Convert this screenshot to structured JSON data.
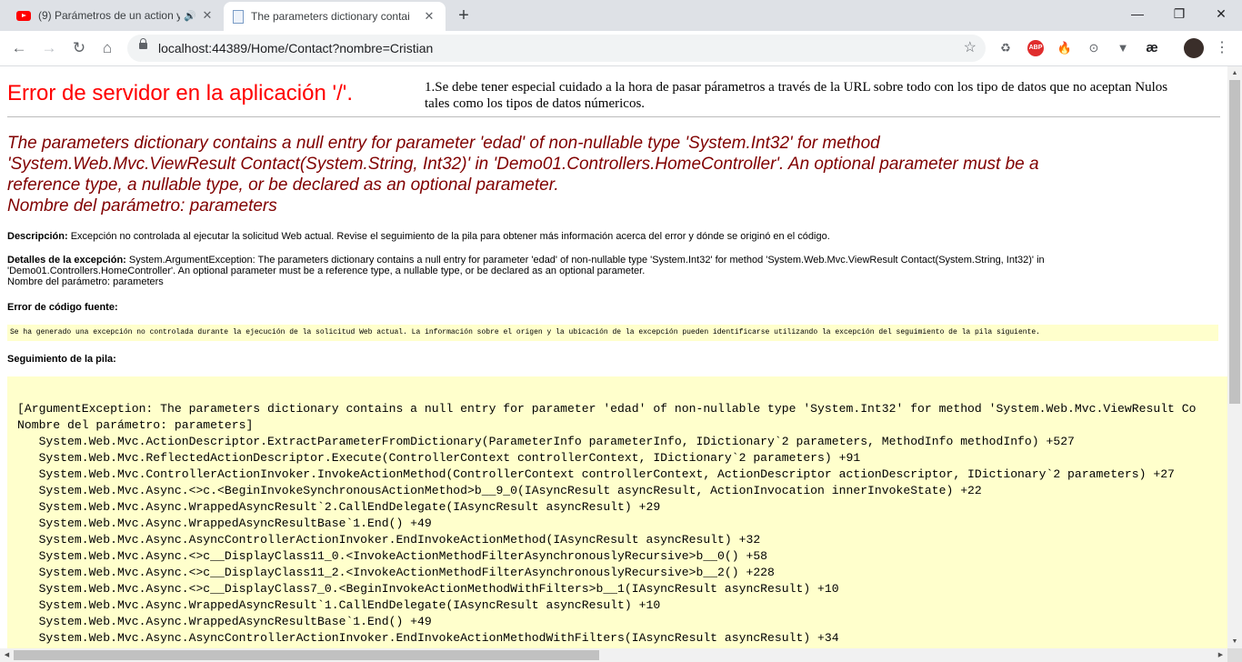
{
  "browser": {
    "tabs": [
      {
        "title": "(9) Parámetros de un action y",
        "icon": "youtube-icon",
        "audio": true
      },
      {
        "title": "The parameters dictionary contai",
        "icon": "document-icon",
        "active": true
      }
    ],
    "new_tab_symbol": "+",
    "window_controls": {
      "minimize": "—",
      "maximize": "❐",
      "close": "✕"
    },
    "nav": {
      "back": "←",
      "forward": "→",
      "reload": "↻",
      "home": "⌂"
    },
    "url": "localhost:44389/Home/Contact?nombre=Cristian",
    "star": "☆",
    "extensions": [
      {
        "name": "recycle-extension-icon",
        "symbol": "♻"
      },
      {
        "name": "adblock-plus-icon",
        "symbol": "ABP"
      },
      {
        "name": "fire-extension-icon",
        "symbol": "🔥"
      },
      {
        "name": "code-extension-icon",
        "symbol": "⊙"
      },
      {
        "name": "v-extension-icon",
        "symbol": "▼"
      },
      {
        "name": "ae-extension-icon",
        "symbol": "æ"
      }
    ],
    "menu": "⋮"
  },
  "page": {
    "heading": "Error de servidor en la aplicación '/'.",
    "note": "1.Se debe tener especial cuidado a la hora de pasar párametros a través de la URL sobre todo con los tipo de datos que no aceptan Nulos tales como los tipos de datos númericos.",
    "error_title_lines": [
      "The parameters dictionary contains a null entry for parameter 'edad' of non-nullable type 'System.Int32' for method",
      "'System.Web.Mvc.ViewResult Contact(System.String, Int32)' in 'Demo01.Controllers.HomeController'. An optional parameter must be a",
      "reference type, a nullable type, or be declared as an optional parameter.",
      "Nombre del parámetro: parameters"
    ],
    "description_label": "Descripción:",
    "description_text": "Excepción no controlada al ejecutar la solicitud Web actual. Revise el seguimiento de la pila para obtener más información acerca del error y dónde se originó en el código.",
    "exception_label": "Detalles de la excepción:",
    "exception_lines": [
      "System.ArgumentException: The parameters dictionary contains a null entry for parameter 'edad' of non-nullable type 'System.Int32' for method 'System.Web.Mvc.ViewResult Contact(System.String, Int32)' in",
      "'Demo01.Controllers.HomeController'. An optional parameter must be a reference type, a nullable type, or be declared as an optional parameter.",
      "Nombre del parámetro: parameters"
    ],
    "source_error_label": "Error de código fuente:",
    "source_error_text": "Se ha generado una excepción no controlada durante la ejecución de la solicitud Web actual. La información sobre el origen y la ubicación de la excepción pueden identificarse utilizando la excepción del seguimiento de la pila siguiente.",
    "stack_label": "Seguimiento de la pila:",
    "stack_lines": [
      "[ArgumentException: The parameters dictionary contains a null entry for parameter 'edad' of non-nullable type 'System.Int32' for method 'System.Web.Mvc.ViewResult Co",
      "Nombre del parámetro: parameters]",
      "   System.Web.Mvc.ActionDescriptor.ExtractParameterFromDictionary(ParameterInfo parameterInfo, IDictionary`2 parameters, MethodInfo methodInfo) +527",
      "   System.Web.Mvc.ReflectedActionDescriptor.Execute(ControllerContext controllerContext, IDictionary`2 parameters) +91",
      "   System.Web.Mvc.ControllerActionInvoker.InvokeActionMethod(ControllerContext controllerContext, ActionDescriptor actionDescriptor, IDictionary`2 parameters) +27",
      "   System.Web.Mvc.Async.<>c.<BeginInvokeSynchronousActionMethod>b__9_0(IAsyncResult asyncResult, ActionInvocation innerInvokeState) +22",
      "   System.Web.Mvc.Async.WrappedAsyncResult`2.CallEndDelegate(IAsyncResult asyncResult) +29",
      "   System.Web.Mvc.Async.WrappedAsyncResultBase`1.End() +49",
      "   System.Web.Mvc.Async.AsyncControllerActionInvoker.EndInvokeActionMethod(IAsyncResult asyncResult) +32",
      "   System.Web.Mvc.Async.<>c__DisplayClass11_0.<InvokeActionMethodFilterAsynchronouslyRecursive>b__0() +58",
      "   System.Web.Mvc.Async.<>c__DisplayClass11_2.<InvokeActionMethodFilterAsynchronouslyRecursive>b__2() +228",
      "   System.Web.Mvc.Async.<>c__DisplayClass7_0.<BeginInvokeActionMethodWithFilters>b__1(IAsyncResult asyncResult) +10",
      "   System.Web.Mvc.Async.WrappedAsyncResult`1.CallEndDelegate(IAsyncResult asyncResult) +10",
      "   System.Web.Mvc.Async.WrappedAsyncResultBase`1.End() +49",
      "   System.Web.Mvc.Async.AsyncControllerActionInvoker.EndInvokeActionMethodWithFilters(IAsyncResult asyncResult) +34"
    ]
  },
  "colors": {
    "heading": "#ff0000",
    "error_title": "#800000",
    "code_background": "#ffffcc"
  }
}
